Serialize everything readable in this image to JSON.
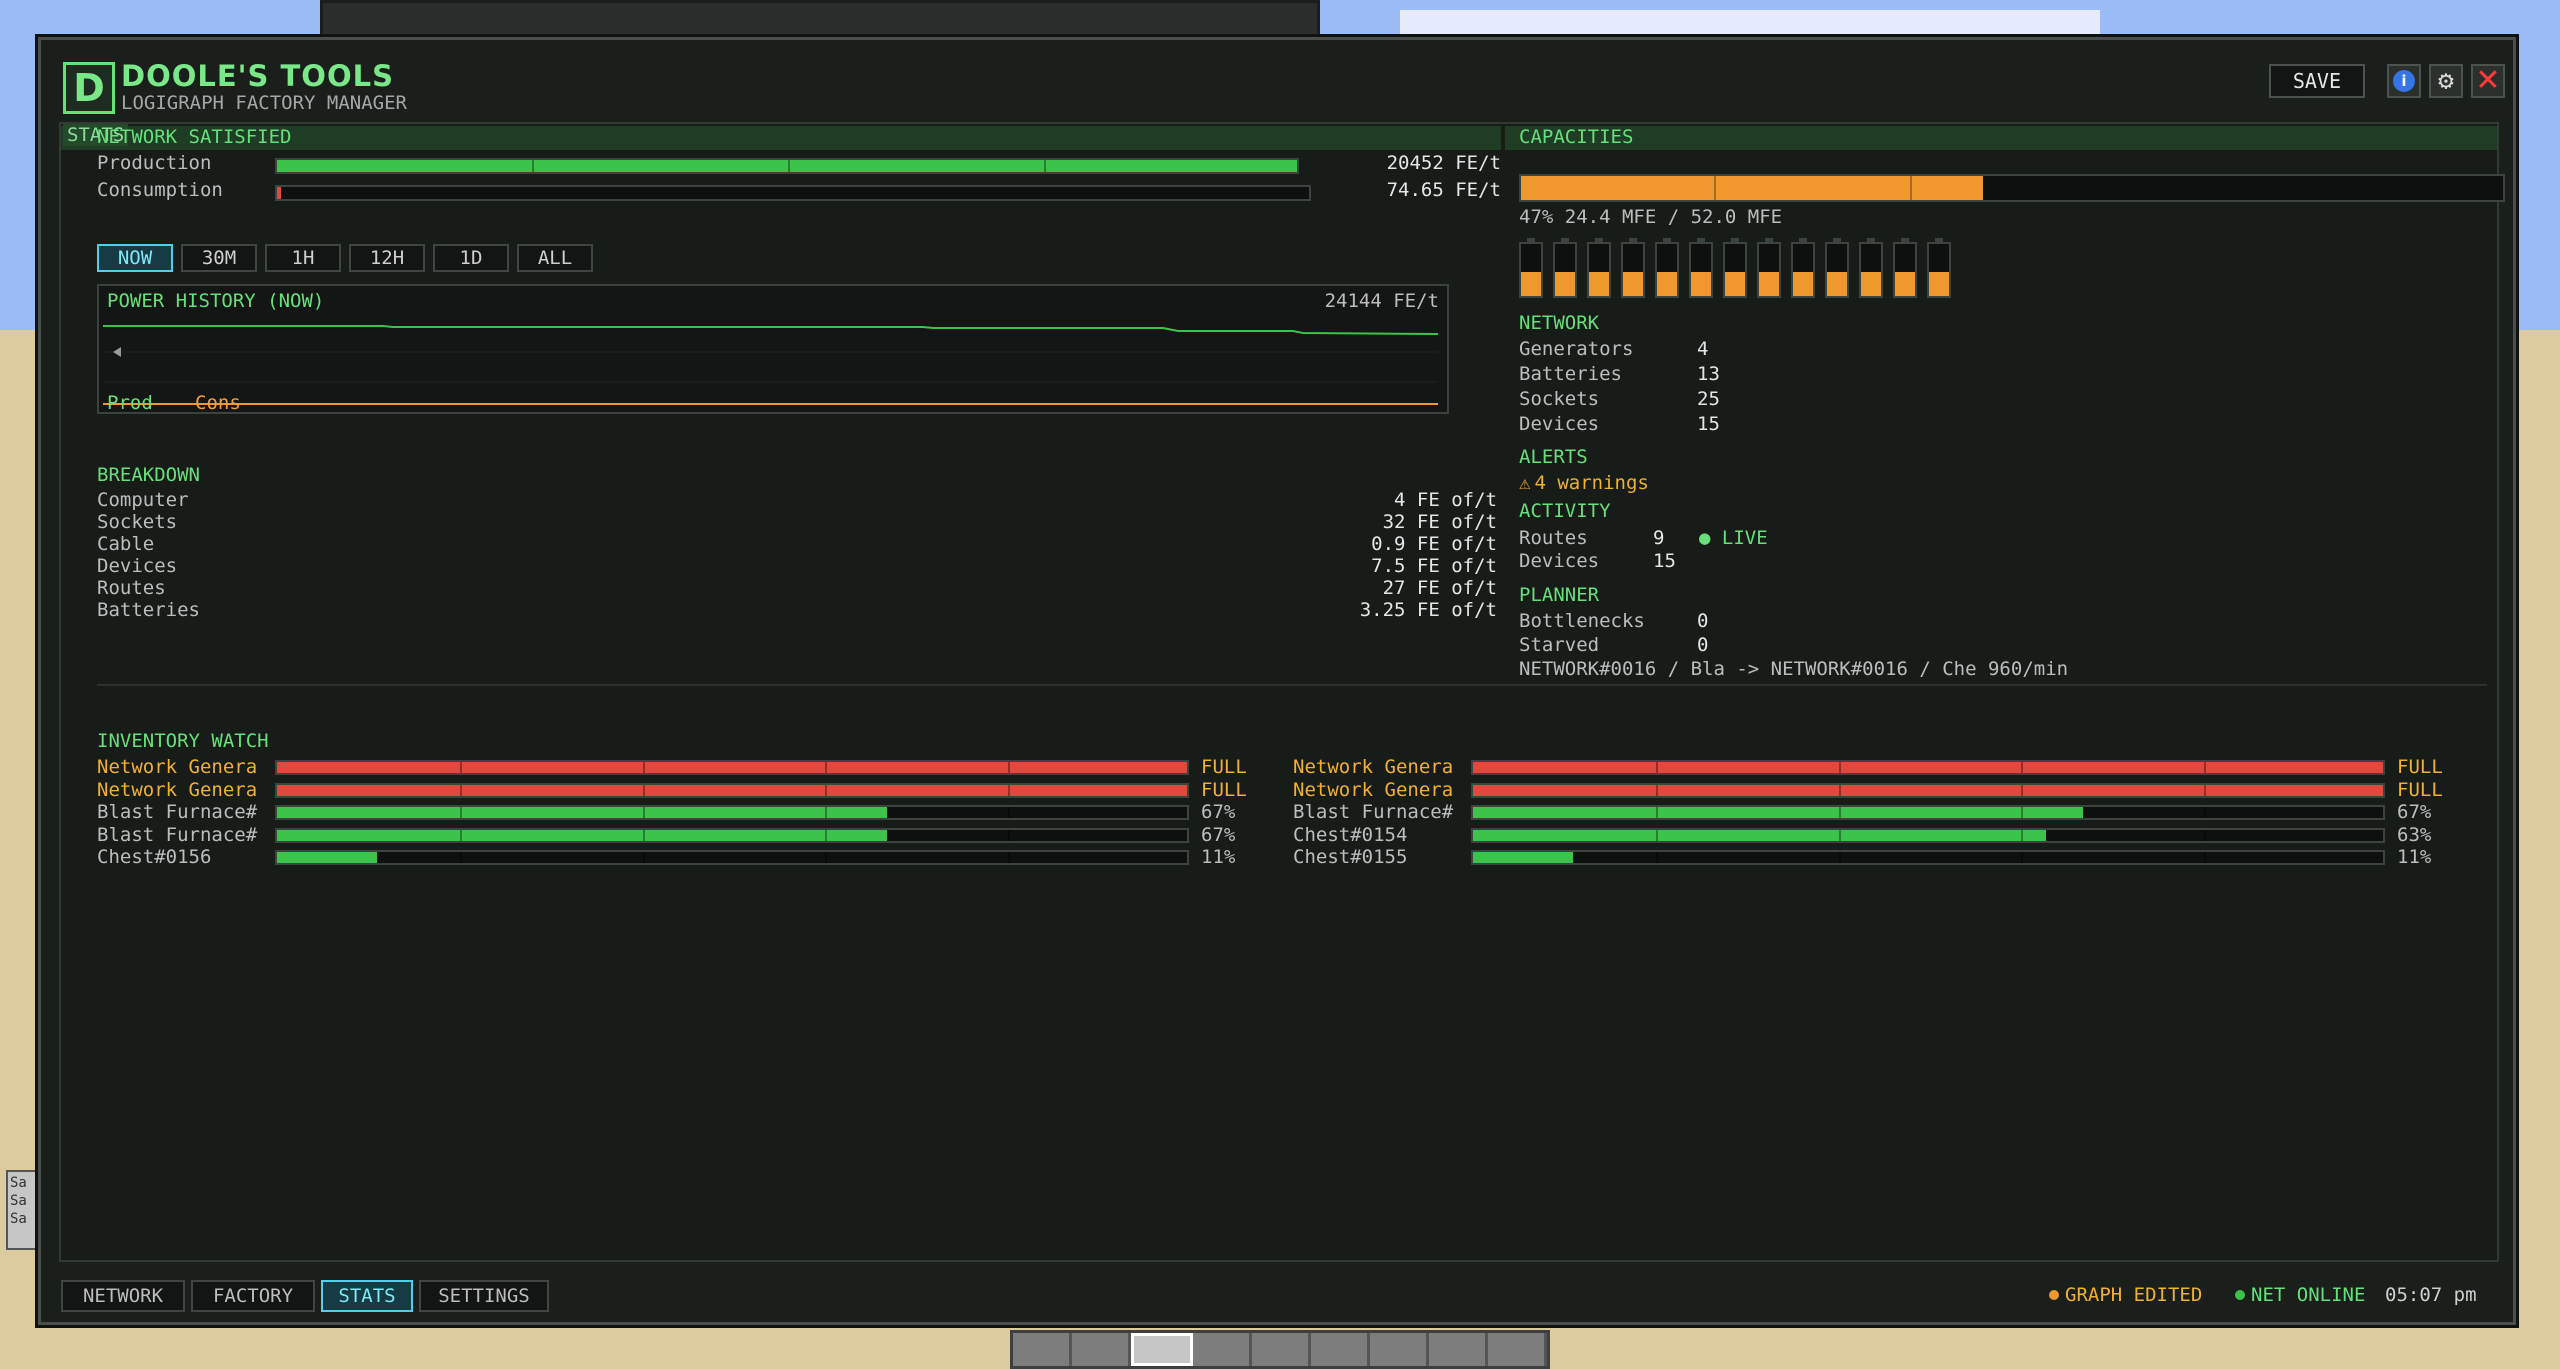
{
  "app": {
    "logo_letter": "D",
    "title": "DOOLE'S TOOLS",
    "subtitle": "LOGIGRAPH FACTORY MANAGER",
    "save_label": "SAVE",
    "icons": [
      "info-icon",
      "gear-icon",
      "close-icon"
    ]
  },
  "stats": {
    "tag": "STATS",
    "network_status": "NETWORK SATISFIED",
    "production": {
      "label": "Production",
      "value": "20452 FE/t",
      "fraction": 1.0
    },
    "consumption": {
      "label": "Consumption",
      "value": "74.65 FE/t",
      "fraction": 0.004
    },
    "ranges": [
      "NOW",
      "30M",
      "1H",
      "12H",
      "1D",
      "ALL"
    ],
    "active_range": "NOW",
    "history": {
      "title": "POWER HISTORY (NOW)",
      "value": "24144 FE/t",
      "legend_prod": "Prod",
      "legend_cons": "Cons"
    },
    "breakdown": {
      "title": "BREAKDOWN",
      "rows": [
        {
          "label": "Computer",
          "value": "4 FE of/t"
        },
        {
          "label": "Sockets",
          "value": "32 FE of/t"
        },
        {
          "label": "Cable",
          "value": "0.9 FE of/t"
        },
        {
          "label": "Devices",
          "value": "7.5 FE of/t"
        },
        {
          "label": "Routes",
          "value": "27 FE of/t"
        },
        {
          "label": "Batteries",
          "value": "3.25 FE of/t"
        }
      ]
    }
  },
  "capacities": {
    "title": "CAPACITIES",
    "fill_fraction": 0.47,
    "summary": "47%  24.4 MFE / 52.0 MFE",
    "battery_count": 13
  },
  "network": {
    "title": "NETWORK",
    "rows": [
      {
        "label": "Generators",
        "value": "4"
      },
      {
        "label": "Batteries",
        "value": "13"
      },
      {
        "label": "Sockets",
        "value": "25"
      },
      {
        "label": "Devices",
        "value": "15"
      }
    ]
  },
  "alerts": {
    "title": "ALERTS",
    "warning_text": "4 warnings"
  },
  "activity": {
    "title": "ACTIVITY",
    "routes_label": "Routes",
    "routes_value": "9",
    "live_label": "LIVE",
    "devices_label": "Devices",
    "devices_value": "15"
  },
  "planner": {
    "title": "PLANNER",
    "bottlenecks_label": "Bottlenecks",
    "bottlenecks_value": "0",
    "starved_label": "Starved",
    "starved_value": "0",
    "route": "NETWORK#0016 / Bla -> NETWORK#0016 / Che 960/min"
  },
  "inventory": {
    "title": "INVENTORY WATCH",
    "left": [
      {
        "name": "Network Genera",
        "pct": "FULL",
        "fraction": 1.0,
        "state": "full"
      },
      {
        "name": "Network Genera",
        "pct": "FULL",
        "fraction": 1.0,
        "state": "full"
      },
      {
        "name": "Blast Furnace#",
        "pct": "67%",
        "fraction": 0.67,
        "state": "norm"
      },
      {
        "name": "Blast Furnace#",
        "pct": "67%",
        "fraction": 0.67,
        "state": "norm"
      },
      {
        "name": "Chest#0156",
        "pct": "11%",
        "fraction": 0.11,
        "state": "norm"
      }
    ],
    "right": [
      {
        "name": "Network Genera",
        "pct": "FULL",
        "fraction": 1.0,
        "state": "full"
      },
      {
        "name": "Network Genera",
        "pct": "FULL",
        "fraction": 1.0,
        "state": "full"
      },
      {
        "name": "Blast Furnace#",
        "pct": "67%",
        "fraction": 0.67,
        "state": "norm"
      },
      {
        "name": "Chest#0154",
        "pct": "63%",
        "fraction": 0.63,
        "state": "norm"
      },
      {
        "name": "Chest#0155",
        "pct": "11%",
        "fraction": 0.11,
        "state": "norm"
      }
    ]
  },
  "bottom": {
    "tabs": [
      "NETWORK",
      "FACTORY",
      "STATS",
      "SETTINGS"
    ],
    "active_tab": "STATS",
    "status_graph": "GRAPH EDITED",
    "status_net": "NET ONLINE",
    "time": "05:07 pm"
  },
  "colors": {
    "accent_green": "#66e07a",
    "bar_green": "#3cc44a",
    "bar_red": "#e04a3c",
    "orange": "#f0982e",
    "cyan_active": "#4ad3e6",
    "warn_yellow": "#f0b030"
  }
}
